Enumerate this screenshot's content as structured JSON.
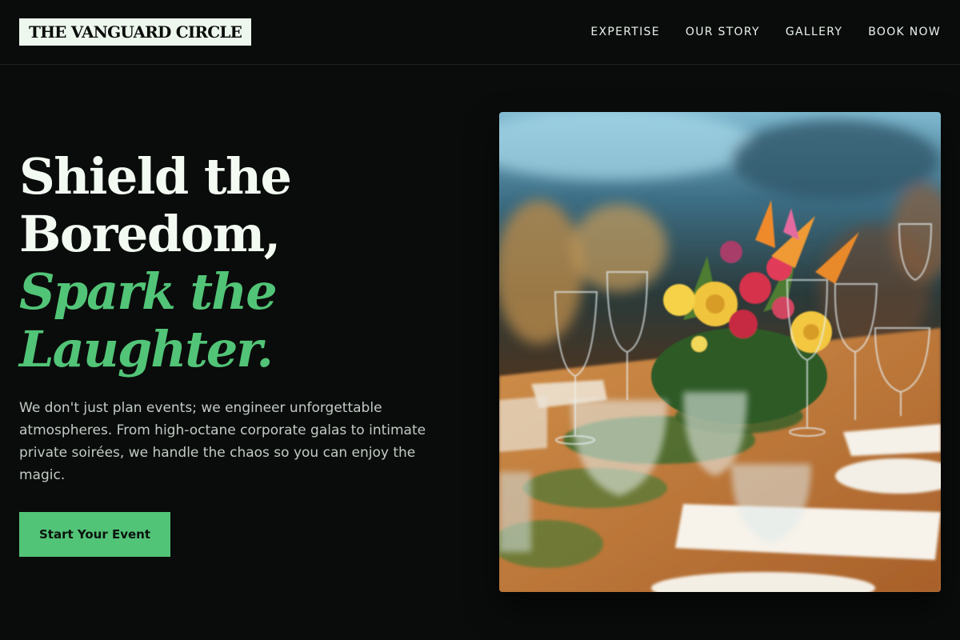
{
  "header": {
    "logo": "THE VANGUARD CIRCLE",
    "nav": [
      "EXPERTISE",
      "OUR STORY",
      "GALLERY",
      "BOOK NOW"
    ]
  },
  "hero": {
    "headline_line1": "Shield the",
    "headline_line2": "Boredom,",
    "headline_line3": "Spark the",
    "headline_line4": "Laughter.",
    "lede": "We don't just plan events; we engineer unforgettable atmospheres. From high-octane corporate galas to intimate private soirées, we handle the chaos so you can enjoy the magic.",
    "cta_label": "Start Your Event"
  },
  "image": {
    "description": "Banquet table with wine glasses and a colorful flower centerpiece"
  },
  "colors": {
    "background": "#0a0c0b",
    "accent": "#52c477",
    "text": "#f2faf2"
  }
}
